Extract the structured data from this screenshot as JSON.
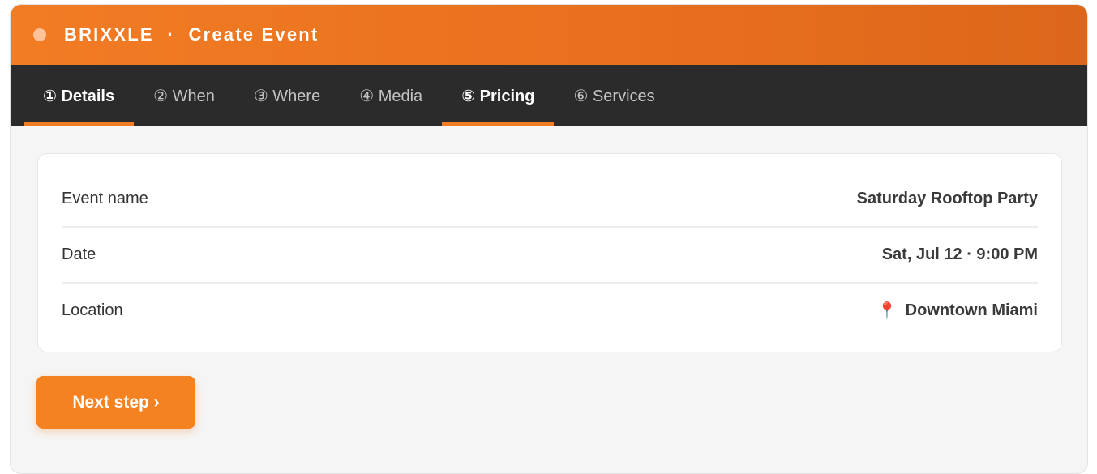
{
  "header": {
    "title": "BRIXXLE  ·  Create Event"
  },
  "tabs": [
    {
      "label": "① Details",
      "active": true
    },
    {
      "label": "② When",
      "active": false
    },
    {
      "label": "③ Where",
      "active": false
    },
    {
      "label": "④ Media",
      "active": false
    },
    {
      "label": "⑤ Pricing",
      "active": true
    },
    {
      "label": "⑥ Services",
      "active": false
    }
  ],
  "summary": {
    "rows": [
      {
        "label": "Event name",
        "value": "Saturday Rooftop Party"
      },
      {
        "label": "Date",
        "value": "Sat, Jul 12 · 9:00 PM"
      },
      {
        "label": "Location",
        "value": "Downtown Miami",
        "icon": "📍"
      }
    ]
  },
  "actions": {
    "next_label": "Next step ›"
  },
  "colors": {
    "accent": "#f27c24",
    "tabbar": "#2b2b2b",
    "background": "#f5f5f5"
  }
}
